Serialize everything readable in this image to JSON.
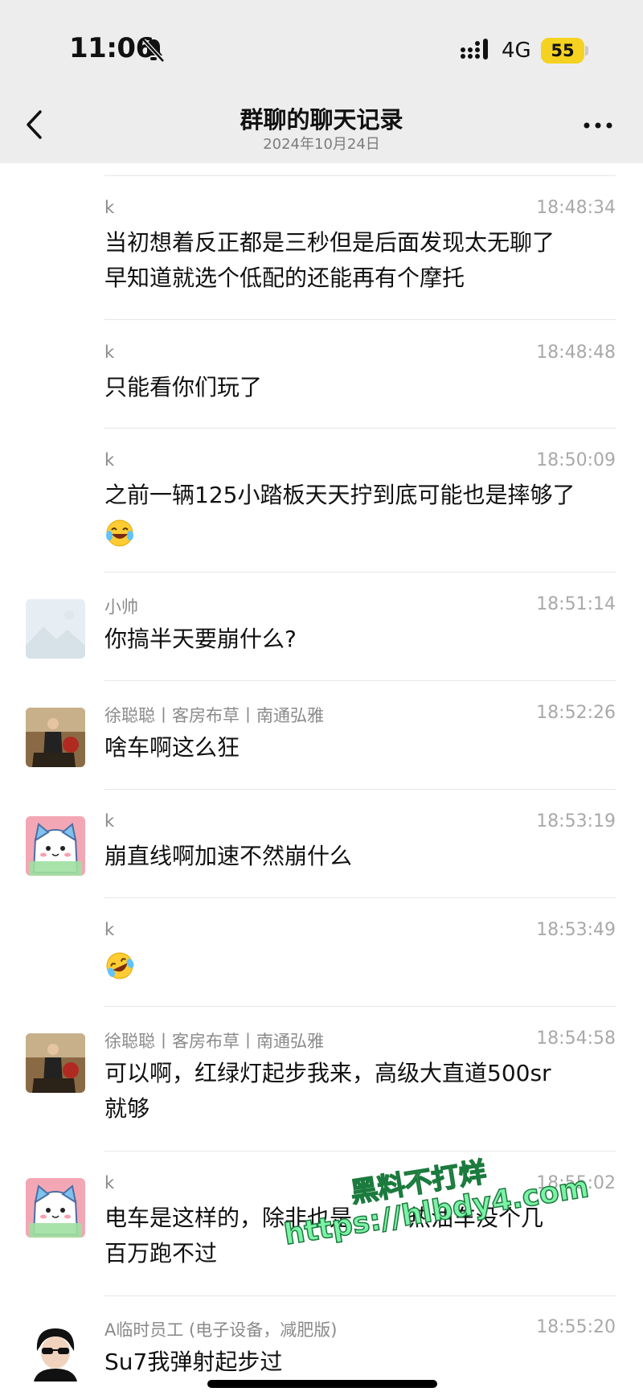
{
  "status": {
    "time": "11:06",
    "network": "4G",
    "battery": "55"
  },
  "header": {
    "title": "群聊的聊天记录",
    "subtitle": "2024年10月24日"
  },
  "messages": [
    {
      "sender": "k",
      "time": "18:48:34",
      "lines": [
        "当初想着反正都是三秒但是后面发现太无聊了",
        "早知道就选个低配的还能再有个摩托"
      ]
    },
    {
      "sender": "k",
      "time": "18:48:48",
      "lines": [
        "只能看你们玩了"
      ]
    },
    {
      "sender": "k",
      "time": "18:50:09",
      "lines": [
        "之前一辆125小踏板天天拧到底可能也是摔够了"
      ],
      "emoji": "laughing-tears-emoji"
    },
    {
      "sender": "小帅",
      "time": "18:51:14",
      "lines": [
        "你搞半天要崩什么?"
      ]
    },
    {
      "sender": "徐聪聪丨客房布草丨南通弘雅",
      "time": "18:52:26",
      "lines": [
        "啥车啊这么狂"
      ]
    },
    {
      "sender": "k",
      "time": "18:53:19",
      "lines": [
        "崩直线啊加速不然崩什么"
      ]
    },
    {
      "sender": "k",
      "time": "18:53:49",
      "lines": [],
      "emoji": "rolling-laughing-emoji"
    },
    {
      "sender": "徐聪聪丨客房布草丨南通弘雅",
      "time": "18:54:58",
      "lines": [
        "可以啊，红绿灯起步我来，高级大直道500sr",
        "就够"
      ]
    },
    {
      "sender": "k",
      "time": "18:55:02",
      "lines": [
        "电车是这样的，除非也是",
        "百万跑不过"
      ]
    },
    {
      "sender": "A临时员工 (电子设备，减肥版)",
      "time": "18:55:20",
      "lines": [
        "Su7我弹射起步过"
      ]
    }
  ],
  "partial_text": "热油车没个几",
  "watermark": {
    "line1": "黑料不打烊",
    "line2": "https://hlbdy4.com"
  }
}
